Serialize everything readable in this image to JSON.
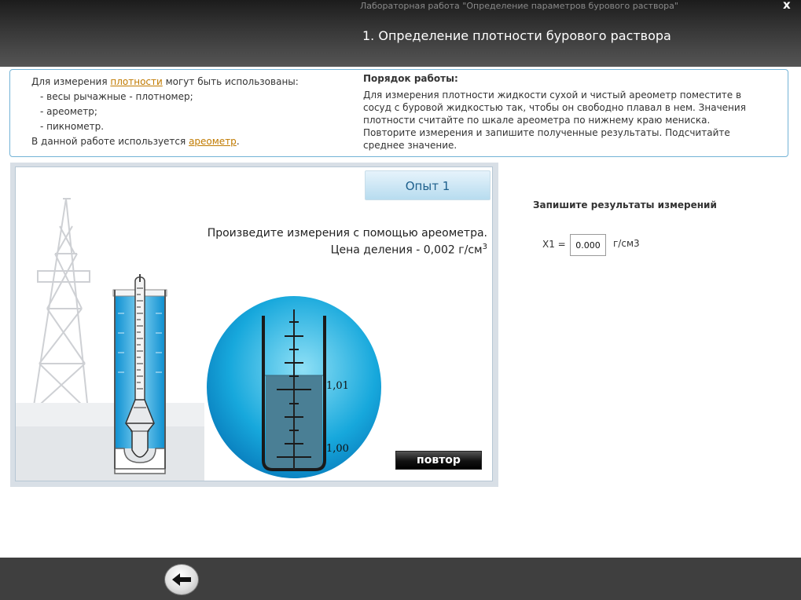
{
  "header": {
    "lab_title": "Лабораторная работа \"Определение параметров бурового раствора\"",
    "close_glyph": "x",
    "section_title": "1. Определение плотности бурового раствора"
  },
  "info": {
    "intro_prefix": "Для измерения ",
    "intro_link": "плотности",
    "intro_suffix": " могут быть использованы:",
    "items": [
      "- весы рычажные - плотномер;",
      "- ареометр;",
      "- пикнометр."
    ],
    "used_prefix": "В данной работе используется ",
    "used_link": "ареометр",
    "used_suffix": ".",
    "procedure_title": "Порядок работы:",
    "procedure_text": "Для измерения плотности жидкости сухой и чистый ареометр поместите в сосуд с буровой жидкостью так, чтобы он свободно плавал в нем. Значения плотности считайте по шкале ареометра по нижнему краю мениска. Повторите измерения и запишите полученные результаты. Подсчитайте среднее значение."
  },
  "experiment": {
    "tab_label": "Опыт 1",
    "instruction_line1": "Произведите измерения с помощью ареометра.",
    "instruction_line2": "Цена деления - 0,002 г/см",
    "instruction_sup": "3",
    "scale_upper": "1,01",
    "scale_lower": "1,00",
    "repeat_button": "повтор"
  },
  "results": {
    "title": "Запишите результаты измерений",
    "x1_label": "X1 =",
    "x1_value": "0.000",
    "x1_unit": "г/см3"
  },
  "footer": {
    "back_icon": "arrow-left-icon"
  },
  "colors": {
    "accent_blue": "#1d5f8c",
    "link_orange": "#c07a00",
    "liquid_blue": "#1aa3d9",
    "panel_border": "#73b3d6"
  }
}
